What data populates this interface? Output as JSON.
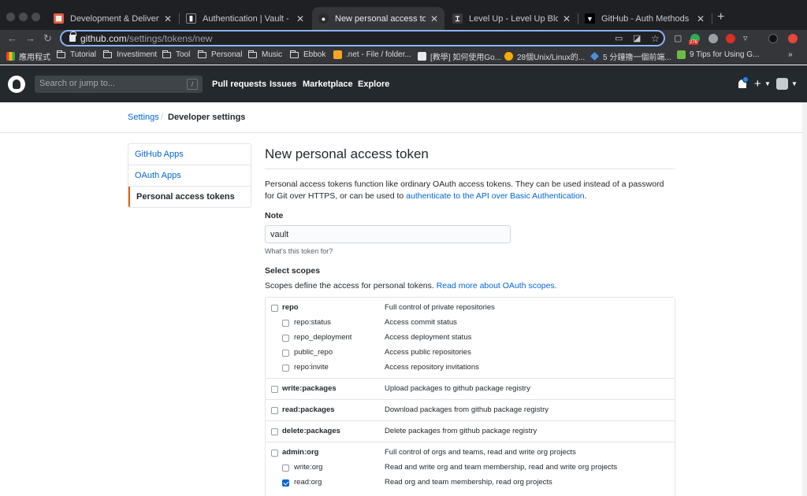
{
  "browser": {
    "tabs": [
      {
        "title": "Development & Delivery | Trello",
        "favicon_color": "#e45d3d",
        "favicon_glyph": "▦"
      },
      {
        "title": "Authentication | Vault - HashiCorp",
        "favicon_color": "#1f2023",
        "favicon_glyph": "▮"
      },
      {
        "title": "New personal access token",
        "favicon_color": "#2b2b2b",
        "favicon_glyph": "●"
      },
      {
        "title": "Level Up - Level Up Blog (https",
        "favicon_color": "#3a3a3a",
        "favicon_glyph": "Ɪ"
      },
      {
        "title": "GitHub - Auth Methods - Vault",
        "favicon_color": "#000000",
        "favicon_glyph": "▼"
      }
    ],
    "url_host": "github.com",
    "url_path": "/settings/tokens/new",
    "bookmarks": [
      {
        "label": "應用程式",
        "icon": "apps-icon"
      },
      {
        "label": "Tutorial",
        "icon": "folder-icon"
      },
      {
        "label": "Investiment",
        "icon": "folder-icon"
      },
      {
        "label": "Tool",
        "icon": "folder-icon"
      },
      {
        "label": "Personal",
        "icon": "folder-icon"
      },
      {
        "label": "Music",
        "icon": "folder-icon"
      },
      {
        "label": "Ebbok",
        "icon": "folder-icon"
      },
      {
        "label": ".net - File / folder...",
        "icon": "pencil-icon"
      },
      {
        "label": "[教學] 如何使用Go...",
        "icon": "page-icon"
      },
      {
        "label": "28個Unix/Linux的...",
        "icon": "page-icon"
      },
      {
        "label": "5 分鐘擼一個前端...",
        "icon": "page-icon"
      },
      {
        "label": "9 Tips for Using G...",
        "icon": "page-icon"
      }
    ],
    "bookmarks_more": "»",
    "extension_badge": "276"
  },
  "header": {
    "search_placeholder": "Search or jump to...",
    "search_key": "/",
    "nav": [
      "Pull requests",
      "Issues",
      "Marketplace",
      "Explore"
    ],
    "plus": "+"
  },
  "breadcrumb": {
    "settings": "Settings",
    "separator": "/",
    "current": "Developer settings"
  },
  "sidebar": {
    "items": [
      {
        "label": "GitHub Apps"
      },
      {
        "label": "OAuth Apps"
      },
      {
        "label": "Personal access tokens"
      }
    ]
  },
  "form": {
    "title": "New personal access token",
    "description": "Personal access tokens function like ordinary OAuth access tokens. They can be used instead of a password for Git over HTTPS, or can be used to ",
    "description_link": "authenticate to the API over Basic Authentication",
    "description_end": ".",
    "note_label": "Note",
    "note_value": "vault",
    "note_hint": "What's this token for?",
    "scopes_label": "Select scopes",
    "scopes_desc": "Scopes define the access for personal tokens. ",
    "scopes_link": "Read more about OAuth scopes."
  },
  "scopes": [
    {
      "name": "repo",
      "desc": "Full control of private repositories",
      "checked": false,
      "child": false
    },
    {
      "name": "repo:status",
      "desc": "Access commit status",
      "checked": false,
      "child": true
    },
    {
      "name": "repo_deployment",
      "desc": "Access deployment status",
      "checked": false,
      "child": true
    },
    {
      "name": "public_repo",
      "desc": "Access public repositories",
      "checked": false,
      "child": true
    },
    {
      "name": "repo:invite",
      "desc": "Access repository invitations",
      "checked": false,
      "child": true
    },
    {
      "name": "write:packages",
      "desc": "Upload packages to github package registry",
      "checked": false,
      "child": false
    },
    {
      "name": "read:packages",
      "desc": "Download packages from github package registry",
      "checked": false,
      "child": false
    },
    {
      "name": "delete:packages",
      "desc": "Delete packages from github package registry",
      "checked": false,
      "child": false
    },
    {
      "name": "admin:org",
      "desc": "Full control of orgs and teams, read and write org projects",
      "checked": false,
      "child": false
    },
    {
      "name": "write:org",
      "desc": "Read and write org and team membership, read and write org projects",
      "checked": false,
      "child": true
    },
    {
      "name": "read:org",
      "desc": "Read org and team membership, read org projects",
      "checked": true,
      "child": true
    }
  ]
}
